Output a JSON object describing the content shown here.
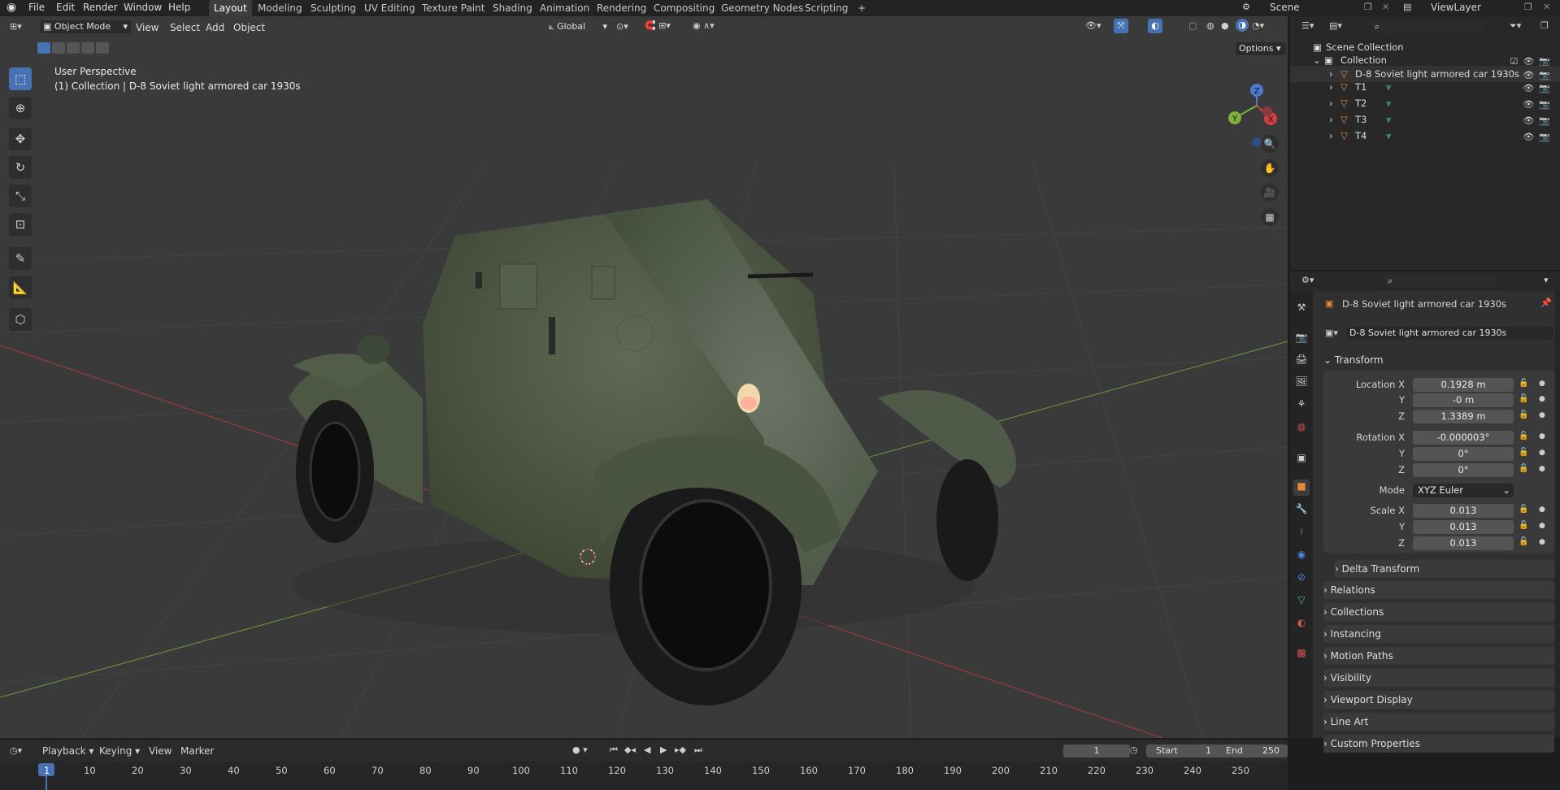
{
  "menus": [
    "File",
    "Edit",
    "Render",
    "Window",
    "Help"
  ],
  "workspaces": [
    "Layout",
    "Modeling",
    "Sculpting",
    "UV Editing",
    "Texture Paint",
    "Shading",
    "Animation",
    "Rendering",
    "Compositing",
    "Geometry Nodes",
    "Scripting"
  ],
  "active_workspace": "Layout",
  "scene_name": "Scene",
  "view_layer": "ViewLayer",
  "viewport": {
    "mode": "Object Mode",
    "menus": [
      "View",
      "Select",
      "Add",
      "Object"
    ],
    "orientation": "Global",
    "options_label": "Options",
    "overlay_title": "User Perspective",
    "overlay_subtitle": "(1) Collection | D-8 Soviet light armored car 1930s",
    "axes": {
      "z": "Z",
      "y": "Y",
      "x": "X"
    }
  },
  "outliner": {
    "root": "Scene Collection",
    "collection": "Collection",
    "objects": [
      "D-8 Soviet light armored car 1930s",
      "T1",
      "T2",
      "T3",
      "T4"
    ]
  },
  "properties": {
    "object_name": "D-8 Soviet light armored car 1930s",
    "datablock_name": "D-8 Soviet light armored car 1930s",
    "transform_label": "Transform",
    "location_label": "Location X",
    "rotation_label": "Rotation X",
    "scale_label": "Scale X",
    "y_label": "Y",
    "z_label": "Z",
    "mode_label": "Mode",
    "location": {
      "x": "0.1928 m",
      "y": "-0 m",
      "z": "1.3389 m"
    },
    "rotation": {
      "x": "-0.000003°",
      "y": "0°",
      "z": "0°"
    },
    "rotation_mode": "XYZ Euler",
    "scale": {
      "x": "0.013",
      "y": "0.013",
      "z": "0.013"
    },
    "delta_transform": "Delta Transform",
    "panels": [
      "Relations",
      "Collections",
      "Instancing",
      "Motion Paths",
      "Visibility",
      "Viewport Display",
      "Line Art",
      "Custom Properties"
    ]
  },
  "timeline": {
    "menus": [
      "Playback",
      "Keying",
      "View",
      "Marker"
    ],
    "current_frame": "1",
    "start_label": "Start",
    "start": "1",
    "end_label": "End",
    "end": "250",
    "ruler": [
      "1",
      "10",
      "20",
      "30",
      "40",
      "50",
      "60",
      "70",
      "80",
      "90",
      "100",
      "110",
      "120",
      "130",
      "140",
      "150",
      "160",
      "170",
      "180",
      "190",
      "200",
      "210",
      "220",
      "230",
      "240",
      "250"
    ]
  }
}
